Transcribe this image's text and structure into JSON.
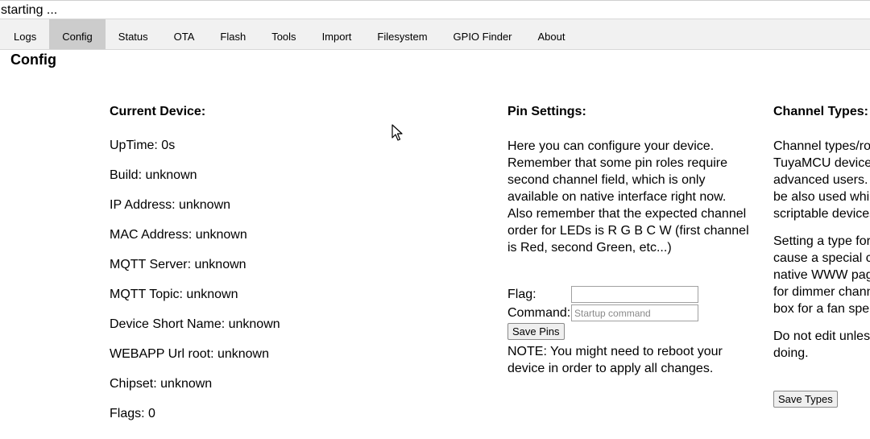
{
  "status": "starting ...",
  "tabs": [
    {
      "label": "Logs"
    },
    {
      "label": "Config"
    },
    {
      "label": "Status"
    },
    {
      "label": "OTA"
    },
    {
      "label": "Flash"
    },
    {
      "label": "Tools"
    },
    {
      "label": "Import"
    },
    {
      "label": "Filesystem"
    },
    {
      "label": "GPIO Finder"
    },
    {
      "label": "About"
    }
  ],
  "page_title": "Config",
  "device": {
    "heading": "Current Device:",
    "rows": [
      "UpTime: 0s",
      "Build: unknown",
      "IP Address: unknown",
      "MAC Address: unknown",
      "MQTT Server: unknown",
      "MQTT Topic: unknown",
      "Device Short Name: unknown",
      "WEBAPP Url root: unknown",
      "Chipset: unknown",
      "Flags: 0"
    ]
  },
  "pins": {
    "heading": "Pin Settings:",
    "lines": [
      "Here you can configure your device.",
      "Remember that some pin roles require",
      "second channel field, which is only",
      "available on native interface right now.",
      "Also remember that the expected channel",
      "order for LEDs is R G B C W (first channel",
      "is Red, second Green, etc...)"
    ],
    "flag_label": "Flag:",
    "flag_value": "",
    "command_label": "Command:",
    "command_placeholder": "Startup command",
    "save_label": "Save Pins",
    "note_lines": [
      "NOTE: You might need to reboot your",
      "device in order to apply all changes."
    ]
  },
  "channels": {
    "heading": "Channel Types:",
    "p1": [
      "Channel types/ro",
      "TuyaMCU devices",
      "advanced users. C",
      "be also used whil",
      "scriptable devices"
    ],
    "p2": [
      "Setting a type for",
      "cause a special co",
      "native WWW pag",
      "for dimmer chann",
      "box for a fan spe"
    ],
    "p3": [
      "Do not edit unles",
      "doing."
    ],
    "save_label": "Save Types"
  }
}
